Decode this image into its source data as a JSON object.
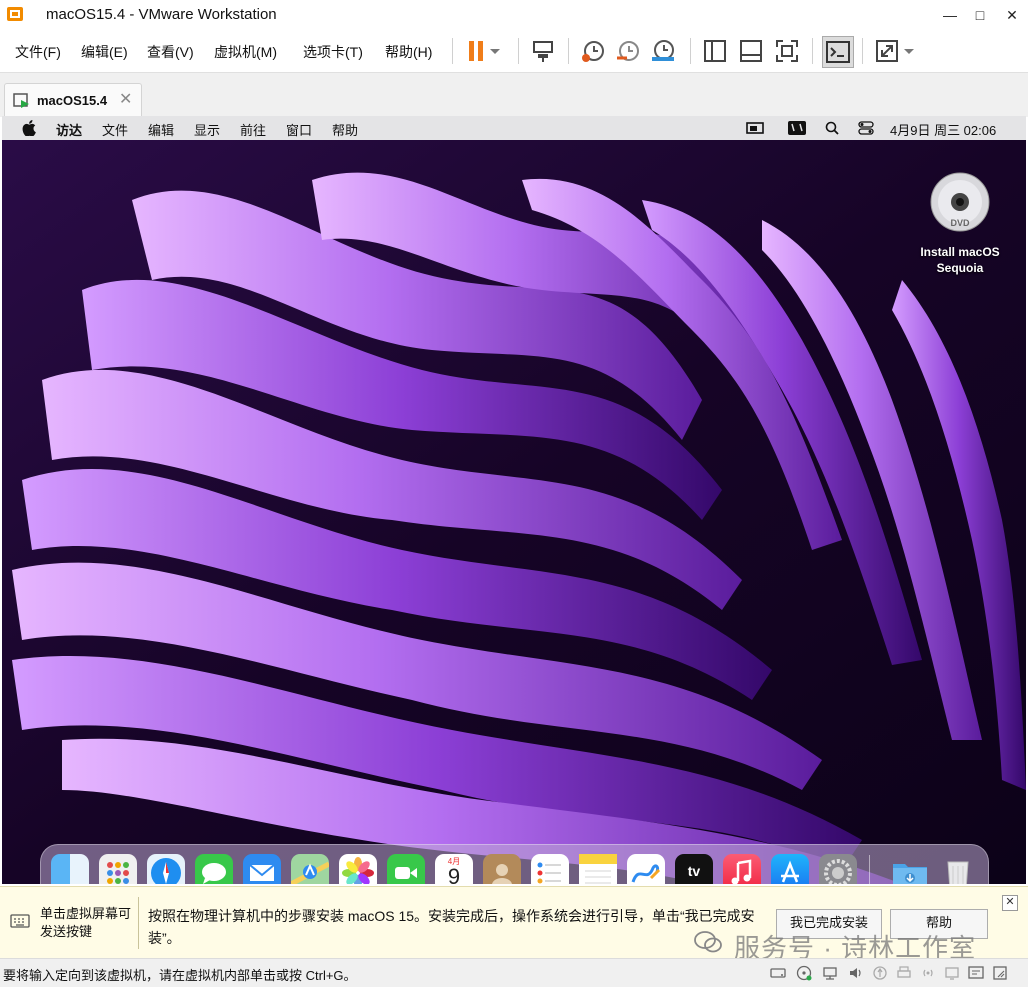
{
  "window": {
    "title": "macOS15.4 - VMware Workstation",
    "minimize": "—",
    "maximize": "□",
    "close": "✕"
  },
  "menu": [
    "文件(F)",
    "编辑(E)",
    "查看(V)",
    "虚拟机(M)",
    "选项卡(T)",
    "帮助(H)"
  ],
  "toolbar_icons": [
    "pause-icon",
    "dropdown-icon",
    "send-ctrl-alt-del-icon",
    "snapshot-take-icon",
    "snapshot-revert-icon",
    "snapshot-manager-icon",
    "view-library-icon",
    "view-thumbnail-icon",
    "fullscreen-icon",
    "console-icon",
    "stretch-icon",
    "dropdown-icon"
  ],
  "tab": {
    "label": "macOS15.4",
    "close": "✕"
  },
  "mac_menubar": {
    "apple": "",
    "items": [
      "访达",
      "文件",
      "编辑",
      "显示",
      "前往",
      "窗口",
      "帮助"
    ],
    "clock": "4月9日 周三  02:06"
  },
  "desktop": {
    "dvd_label_line1": "Install macOS",
    "dvd_label_line2": "Sequoia",
    "dvd_text": "DVD"
  },
  "dock": {
    "items": [
      "finder-icon",
      "launchpad-icon",
      "safari-icon",
      "messages-icon",
      "mail-icon",
      "maps-icon",
      "photos-icon",
      "facetime-icon",
      "calendar-icon",
      "contacts-icon",
      "reminders-icon",
      "notes-icon",
      "freeform-icon",
      "appletv-icon",
      "music-icon",
      "appstore-icon",
      "settings-icon",
      "downloads-folder-icon",
      "trash-icon"
    ],
    "calendar_month": "4月",
    "calendar_day": "9",
    "tv_text": "tv"
  },
  "hint": {
    "left": "单击虚拟屏幕可发送按键",
    "main": "按照在物理计算机中的步骤安装 macOS 15。安装完成后，操作系统会进行引导，单击“我已完成安装”。",
    "done_button": "我已完成安装",
    "help_button": "帮助",
    "close": "✕"
  },
  "watermark": "服务号 · 诗林工作室",
  "status": {
    "text": "要将输入定向到该虚拟机，请在虚拟机内部单击或按 Ctrl+G。"
  },
  "colors": {
    "pause_orange": "#f07d19",
    "wallpaper_dark": "#1a0629",
    "wallpaper_purple": "#9b5de5",
    "hint_bg": "#fffce6"
  }
}
